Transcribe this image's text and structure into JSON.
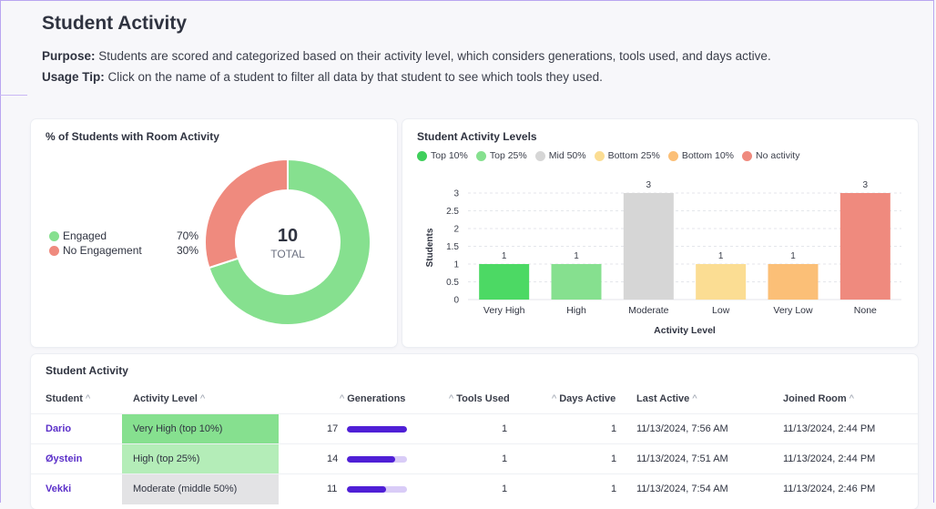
{
  "header": {
    "title": "Student Activity",
    "purpose_label": "Purpose:",
    "purpose_text": " Students are scored and categorized based on their activity level, which considers generations, tools used, and days active.",
    "tip_label": "Usage Tip:",
    "tip_text": " Click on the name of a student to filter all data by that student to see which tools they used."
  },
  "donut": {
    "title": "% of Students with Room Activity",
    "total_value": "10",
    "total_label": "TOTAL",
    "legend": [
      {
        "label": "Engaged",
        "pct": "70%",
        "color": "#86e08f"
      },
      {
        "label": "No Engagement",
        "pct": "30%",
        "color": "#ef8a7e"
      }
    ],
    "fractions": [
      0.7,
      0.3
    ]
  },
  "bar_card": {
    "title": "Student Activity Levels",
    "legend": [
      {
        "label": "Top 10%",
        "color": "#3fcf5b"
      },
      {
        "label": "Top 25%",
        "color": "#86e08f"
      },
      {
        "label": "Mid 50%",
        "color": "#d6d6d6"
      },
      {
        "label": "Bottom 25%",
        "color": "#fbdd93"
      },
      {
        "label": "Bottom 10%",
        "color": "#fbbf77"
      },
      {
        "label": "No activity",
        "color": "#ef8a7e"
      }
    ]
  },
  "chart_data": {
    "type": "bar",
    "title": "Student Activity Levels",
    "xlabel": "Activity Level",
    "ylabel": "Students",
    "categories": [
      "Very High",
      "High",
      "Moderate",
      "Low",
      "Very Low",
      "None"
    ],
    "values": [
      1,
      1,
      3,
      1,
      1,
      3
    ],
    "colors": [
      "#4cd964",
      "#86e08f",
      "#d6d6d6",
      "#fbdd93",
      "#fbbf77",
      "#ef8a7e"
    ],
    "yticks": [
      "0",
      "0.5",
      "1",
      "1.5",
      "2",
      "2.5",
      "3"
    ],
    "ylim": [
      0,
      3
    ],
    "grid": true
  },
  "table": {
    "title": "Student Activity",
    "headers": {
      "student": "Student",
      "level": "Activity Level",
      "generations": "Generations",
      "tools": "Tools Used",
      "days": "Days Active",
      "last": "Last Active",
      "joined": "Joined Room"
    },
    "rows": [
      {
        "student": "Dario",
        "level": "Very High (top 10%)",
        "level_color": "#86e08f",
        "generations": "17",
        "gen_fraction": 1.0,
        "tools": "1",
        "days": "1",
        "last": "11/13/2024, 7:56 AM",
        "joined": "11/13/2024, 2:44 PM"
      },
      {
        "student": "Øystein",
        "level": "High (top 25%)",
        "level_color": "#b4edb8",
        "generations": "14",
        "gen_fraction": 0.8,
        "tools": "1",
        "days": "1",
        "last": "11/13/2024, 7:51 AM",
        "joined": "11/13/2024, 2:44 PM"
      },
      {
        "student": "Vekki",
        "level": "Moderate (middle 50%)",
        "level_color": "#e3e3e5",
        "generations": "11",
        "gen_fraction": 0.65,
        "tools": "1",
        "days": "1",
        "last": "11/13/2024, 7:54 AM",
        "joined": "11/13/2024, 2:46 PM"
      }
    ]
  }
}
